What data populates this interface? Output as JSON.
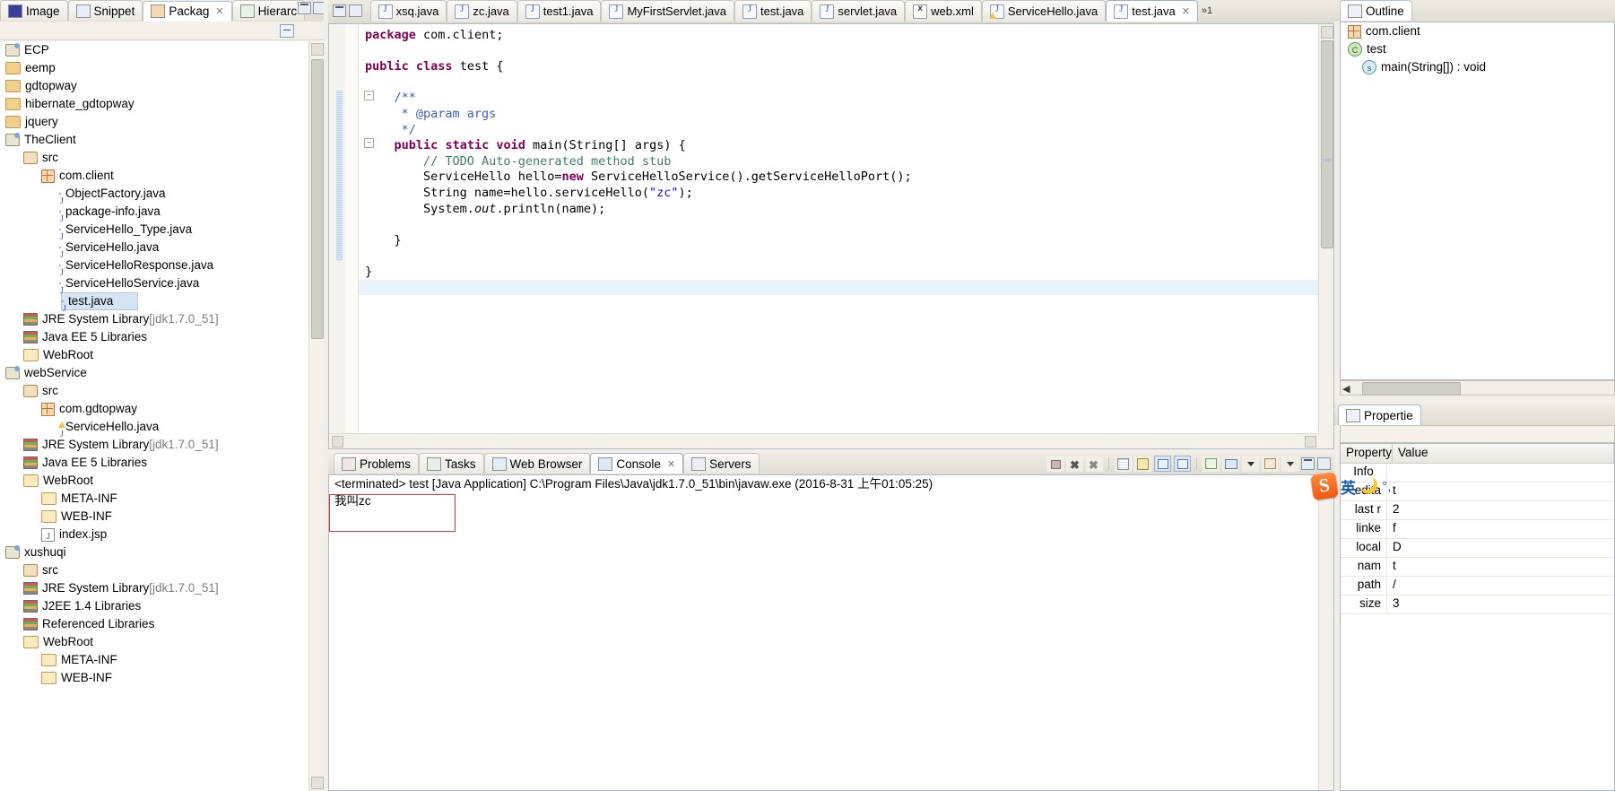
{
  "left_panel": {
    "view_tabs": [
      {
        "label": "Image",
        "icon": "image-icon",
        "active": false,
        "closable": false
      },
      {
        "label": "Snippet",
        "icon": "snippet-icon",
        "active": false,
        "closable": false
      },
      {
        "label": "Packag",
        "icon": "package-explorer-icon",
        "active": true,
        "closable": true
      },
      {
        "label": "Hierarc",
        "icon": "type-hierarchy-icon",
        "active": false,
        "closable": false
      }
    ],
    "toolbar": {
      "collapse_all": "collapse-all-icon",
      "link_with_editor": "link-with-editor-icon",
      "view_menu": "view-menu-icon",
      "minimize": "minimize-icon",
      "maximize": "maximize-icon"
    },
    "tree": [
      {
        "label": "ECP",
        "indent": 1,
        "icon": "project-icon",
        "selected": false
      },
      {
        "label": "eemp",
        "indent": 1,
        "icon": "folder-icon",
        "selected": false
      },
      {
        "label": "gdtopway",
        "indent": 1,
        "icon": "folder-icon",
        "selected": false
      },
      {
        "label": "hibernate_gdtopway",
        "indent": 1,
        "icon": "folder-icon",
        "selected": false
      },
      {
        "label": "jquery",
        "indent": 1,
        "icon": "folder-icon",
        "selected": false
      },
      {
        "label": "TheClient",
        "indent": 1,
        "icon": "project-icon",
        "selected": false
      },
      {
        "label": "src",
        "indent": 2,
        "icon": "source-folder-icon",
        "selected": false
      },
      {
        "label": "com.client",
        "indent": 3,
        "icon": "package-icon",
        "selected": false
      },
      {
        "label": "ObjectFactory.java",
        "indent": 4,
        "icon": "java-file-icon",
        "selected": false
      },
      {
        "label": "package-info.java",
        "indent": 4,
        "icon": "java-file-icon",
        "selected": false
      },
      {
        "label": "ServiceHello_Type.java",
        "indent": 4,
        "icon": "java-file-icon",
        "selected": false
      },
      {
        "label": "ServiceHello.java",
        "indent": 4,
        "icon": "java-file-icon",
        "selected": false
      },
      {
        "label": "ServiceHelloResponse.java",
        "indent": 4,
        "icon": "java-file-icon",
        "selected": false
      },
      {
        "label": "ServiceHelloService.java",
        "indent": 4,
        "icon": "java-file-icon",
        "selected": false
      },
      {
        "label": "test.java",
        "indent": 4,
        "icon": "java-file-icon",
        "selected": true
      },
      {
        "label": "JRE System Library",
        "suffix": "[jdk1.7.0_51]",
        "indent": 2,
        "icon": "library-icon",
        "selected": false
      },
      {
        "label": "Java EE 5 Libraries",
        "indent": 2,
        "icon": "library-icon",
        "selected": false
      },
      {
        "label": "WebRoot",
        "indent": 2,
        "icon": "folder-open-icon",
        "selected": false
      },
      {
        "label": "webService",
        "indent": 1,
        "icon": "project-icon",
        "selected": false
      },
      {
        "label": "src",
        "indent": 2,
        "icon": "source-folder-icon",
        "selected": false
      },
      {
        "label": "com.gdtopway",
        "indent": 3,
        "icon": "package-icon",
        "selected": false
      },
      {
        "label": "ServiceHello.java",
        "indent": 4,
        "icon": "java-file-warning-icon",
        "selected": false
      },
      {
        "label": "JRE System Library",
        "suffix": "[jdk1.7.0_51]",
        "indent": 2,
        "icon": "library-icon",
        "selected": false
      },
      {
        "label": "Java EE 5 Libraries",
        "indent": 2,
        "icon": "library-icon",
        "selected": false
      },
      {
        "label": "WebRoot",
        "indent": 2,
        "icon": "folder-open-icon",
        "selected": false
      },
      {
        "label": "META-INF",
        "indent": 3,
        "icon": "folder-open-icon",
        "selected": false
      },
      {
        "label": "WEB-INF",
        "indent": 3,
        "icon": "folder-open-icon",
        "selected": false
      },
      {
        "label": "index.jsp",
        "indent": 3,
        "icon": "jsp-file-icon",
        "selected": false
      },
      {
        "label": "xushuqi",
        "indent": 1,
        "icon": "project-icon",
        "selected": false
      },
      {
        "label": "src",
        "indent": 2,
        "icon": "source-folder-icon",
        "selected": false
      },
      {
        "label": "JRE System Library",
        "suffix": "[jdk1.7.0_51]",
        "indent": 2,
        "icon": "library-icon",
        "selected": false
      },
      {
        "label": "J2EE 1.4 Libraries",
        "indent": 2,
        "icon": "library-icon",
        "selected": false
      },
      {
        "label": "Referenced Libraries",
        "indent": 2,
        "icon": "library-icon",
        "selected": false
      },
      {
        "label": "WebRoot",
        "indent": 2,
        "icon": "folder-open-icon",
        "selected": false
      },
      {
        "label": "META-INF",
        "indent": 3,
        "icon": "folder-open-icon",
        "selected": false
      },
      {
        "label": "WEB-INF",
        "indent": 3,
        "icon": "folder-open-icon",
        "selected": false
      }
    ]
  },
  "editor": {
    "tabs": [
      {
        "label": "xsq.java",
        "icon": "java-file-icon",
        "active": false,
        "closable": false
      },
      {
        "label": "zc.java",
        "icon": "java-file-icon",
        "active": false,
        "closable": false
      },
      {
        "label": "test1.java",
        "icon": "java-file-icon",
        "active": false,
        "closable": false
      },
      {
        "label": "MyFirstServlet.java",
        "icon": "java-file-icon",
        "active": false,
        "closable": false
      },
      {
        "label": "test.java",
        "icon": "java-file-icon",
        "active": false,
        "closable": false
      },
      {
        "label": "servlet.java",
        "icon": "java-file-icon",
        "active": false,
        "closable": false
      },
      {
        "label": "web.xml",
        "icon": "xml-file-icon",
        "active": false,
        "closable": false
      },
      {
        "label": "ServiceHello.java",
        "icon": "java-file-warning-icon",
        "active": false,
        "closable": false
      },
      {
        "label": "test.java",
        "icon": "java-file-icon",
        "active": true,
        "closable": true
      }
    ],
    "more_tabs_indicator": "»1",
    "restore_label": "restore-icon",
    "maximize_label": "maximize-icon",
    "code_lines": [
      {
        "kind": "kw-line",
        "text": "package com.client;"
      },
      {
        "kind": "blank",
        "text": ""
      },
      {
        "kind": "kw-line",
        "text": "public class test {"
      },
      {
        "kind": "blank",
        "text": ""
      },
      {
        "kind": "jdoc",
        "text": "    /**"
      },
      {
        "kind": "jdoc",
        "text": "     * @param args"
      },
      {
        "kind": "jdoc",
        "text": "     */"
      },
      {
        "kind": "kw-line",
        "text": "    public static void main(String[] args) {"
      },
      {
        "kind": "comment",
        "text": "        // TODO Auto-generated method stub"
      },
      {
        "kind": "code",
        "text": "        ServiceHello hello=new ServiceHelloService().getServiceHelloPort();"
      },
      {
        "kind": "code",
        "text": "        String name=hello.serviceHello(\"zc\");"
      },
      {
        "kind": "code",
        "text": "        System.out.println(name);"
      },
      {
        "kind": "blank",
        "text": ""
      },
      {
        "kind": "code",
        "text": "    }"
      },
      {
        "kind": "blank",
        "text": ""
      },
      {
        "kind": "code",
        "text": "}"
      }
    ],
    "code_tokens": {
      "package": "package",
      "package_name": "com.client",
      "public": "public",
      "class": "class",
      "class_name": "test",
      "static": "static",
      "void": "void",
      "main": "main",
      "string_arr": "String[] args",
      "javadoc_open": "/**",
      "javadoc_param": "* @param args",
      "javadoc_close": "*/",
      "todo_comment": "// TODO Auto-generated method stub",
      "line_servicehello": "ServiceHello hello=",
      "new": "new",
      "new_call": " ServiceHelloService().getServiceHelloPort();",
      "line_string": "String name=hello.serviceHello(",
      "string_zc": "\"zc\"",
      "line_string_end": ");",
      "line_sysout_a": "System.",
      "line_sysout_out": "out",
      "line_sysout_b": ".println(name);"
    }
  },
  "bottom_panel": {
    "tabs": [
      {
        "label": "Problems",
        "icon": "problems-icon",
        "active": false,
        "closable": false
      },
      {
        "label": "Tasks",
        "icon": "tasks-icon",
        "active": false,
        "closable": false
      },
      {
        "label": "Web Browser",
        "icon": "web-browser-icon",
        "active": false,
        "closable": false
      },
      {
        "label": "Console",
        "icon": "console-icon",
        "active": true,
        "closable": true
      },
      {
        "label": "Servers",
        "icon": "servers-icon",
        "active": false,
        "closable": false
      }
    ],
    "toolbar_icons": [
      "terminate-icon",
      "remove-launch-icon",
      "remove-all-launches-icon",
      "clear-console-icon",
      "scroll-lock-icon",
      "word-wrap-icon",
      "pin-console-icon",
      "display-selected-console-icon",
      "console-menu-icon",
      "open-console-icon",
      "open-console-menu-icon",
      "minimize-icon",
      "maximize-icon"
    ],
    "console": {
      "header": "<terminated> test [Java Application] C:\\Program Files\\Java\\jdk1.7.0_51\\bin\\javaw.exe (2016-8-31 上午01:05:25)",
      "output": "我叫zc",
      "highlight_color": "#e03b3b"
    }
  },
  "right_panel": {
    "outline_tab": {
      "label": "Outline",
      "icon": "outline-icon",
      "active": true
    },
    "outline_items": [
      {
        "label": "com.client",
        "icon": "package-declaration-icon",
        "indent": 1
      },
      {
        "label": "test",
        "icon": "class-icon",
        "indent": 1
      },
      {
        "label": "main(String[]) : void",
        "icon": "static-method-icon",
        "indent": 2
      }
    ],
    "properties_tab": {
      "label": "Propertie",
      "icon": "properties-icon",
      "active": true
    },
    "properties_headers": [
      "Property",
      "Value"
    ],
    "properties_rows": [
      {
        "key": "Info",
        "value": "",
        "group": true
      },
      {
        "key": "edita",
        "value": "t"
      },
      {
        "key": "last r",
        "value": "2"
      },
      {
        "key": "linke",
        "value": "f"
      },
      {
        "key": "local",
        "value": "D"
      },
      {
        "key": "nam",
        "value": "t"
      },
      {
        "key": "path",
        "value": "/"
      },
      {
        "key": "size",
        "value": "3"
      }
    ]
  },
  "ime": {
    "logo": "sogou-pinyin-logo",
    "mode_label": "英",
    "moon_icon": "moon-icon",
    "punct_icon": "punctuation-icon"
  },
  "colors": {
    "accent": "#3b5fa8",
    "keyword": "#7f0055",
    "string": "#2a00ff",
    "comment": "#3f7f5f",
    "javadoc": "#3f5fbf",
    "highlight_box": "#e03b3b",
    "active_tab_bg": "#ffffff",
    "chrome_bg": "#f1efe8"
  }
}
